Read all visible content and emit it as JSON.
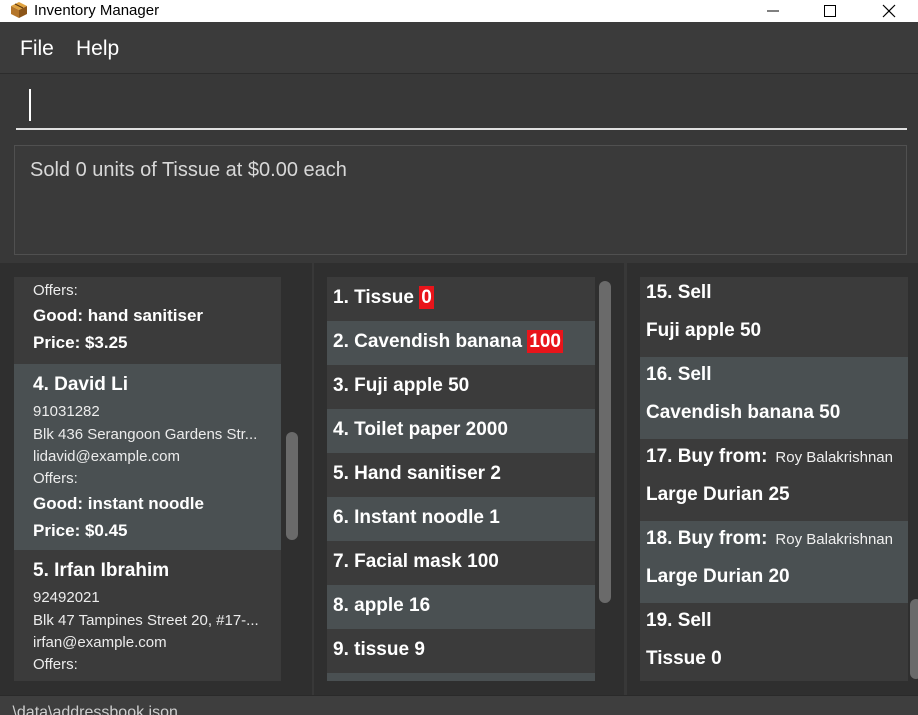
{
  "window": {
    "title": "Inventory Manager",
    "app_icon": "box-icon",
    "controls": [
      "minimize-icon",
      "maximize-icon",
      "close-icon"
    ]
  },
  "menu": {
    "file": "File",
    "help": "Help"
  },
  "command": {
    "value": "",
    "placeholder": ""
  },
  "result": {
    "message": "Sold 0 units of Tissue at $0.00 each"
  },
  "persons": [
    {
      "offers_label": "Offers:",
      "good": "Good: hand sanitiser",
      "price": "Price: $3.25"
    },
    {
      "index_name": "4.  David Li",
      "phone": "91031282",
      "address": "Blk 436 Serangoon Gardens Str...",
      "email": "lidavid@example.com",
      "offers_label": "Offers:",
      "good": "Good: instant noodle",
      "price": "Price: $0.45"
    },
    {
      "index_name": "5.  Irfan Ibrahim",
      "phone": "92492021",
      "address": "Blk 47 Tampines Street 20, #17-...",
      "email": "irfan@example.com",
      "offers_label": "Offers:"
    }
  ],
  "goods": [
    {
      "label": "1.  Tissue ",
      "qty": "0",
      "low": true
    },
    {
      "label": "2.  Cavendish banana ",
      "qty": "100",
      "low": true
    },
    {
      "label": "3.  Fuji apple 50",
      "qty": "",
      "low": false
    },
    {
      "label": "4.  Toilet paper 2000",
      "qty": "",
      "low": false
    },
    {
      "label": "5.  Hand sanitiser 2",
      "qty": "",
      "low": false
    },
    {
      "label": "6.  Instant noodle 1",
      "qty": "",
      "low": false
    },
    {
      "label": "7.  Facial mask 100",
      "qty": "",
      "low": false
    },
    {
      "label": "8.  apple 16",
      "qty": "",
      "low": false
    },
    {
      "label": "9.  tissue 9",
      "qty": "",
      "low": false
    }
  ],
  "transactions": [
    {
      "head": "15.  Sell",
      "party": "",
      "detail": "Fuji apple 50"
    },
    {
      "head": "16.  Sell",
      "party": "",
      "detail": "Cavendish banana 50"
    },
    {
      "head": "17.  Buy from:",
      "party": "Roy Balakrishnan",
      "detail": "Large Durian 25"
    },
    {
      "head": "18.  Buy from:",
      "party": "Roy Balakrishnan",
      "detail": "Large Durian 20"
    },
    {
      "head": "19.  Sell",
      "party": "",
      "detail": "Tissue 0"
    }
  ],
  "status": {
    "path": ".\\data\\addressbook.json"
  },
  "colors": {
    "background": "#383838",
    "alt_row": "#4a5052",
    "low_stock": "#e8141a"
  }
}
